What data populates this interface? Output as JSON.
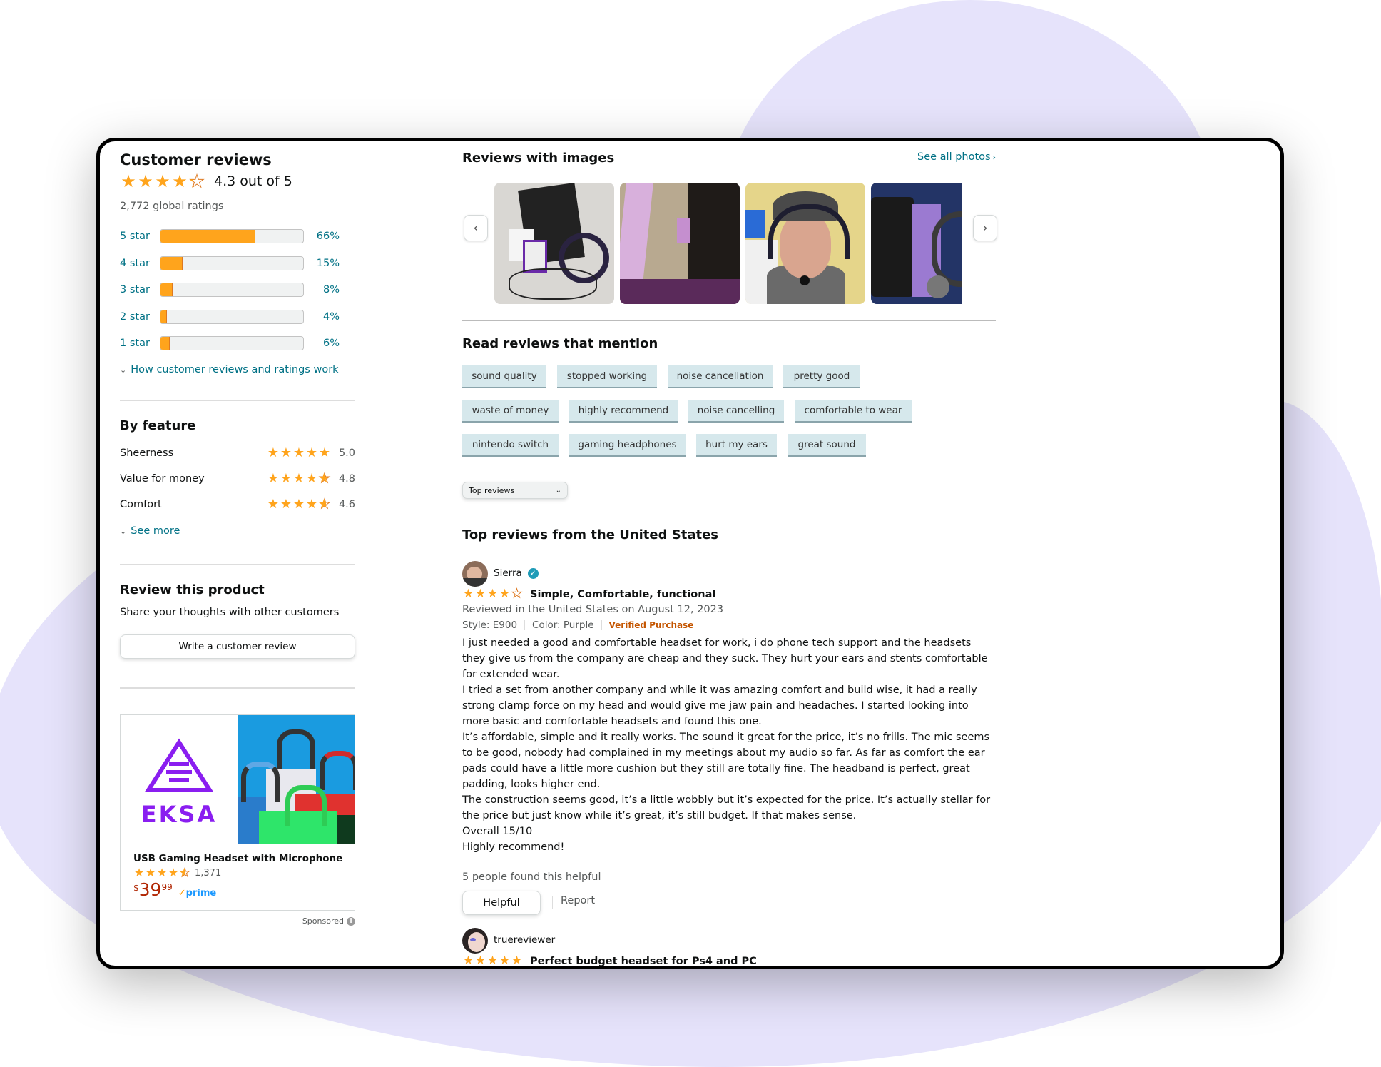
{
  "summary": {
    "title": "Customer reviews",
    "rating_value": 4.3,
    "rating_text": "4.3 out of 5",
    "global_ratings": "2,772 global ratings",
    "histogram": [
      {
        "label": "5 star",
        "percent": 66,
        "percent_text": "66%"
      },
      {
        "label": "4 star",
        "percent": 15,
        "percent_text": "15%"
      },
      {
        "label": "3 star",
        "percent": 8,
        "percent_text": "8%"
      },
      {
        "label": "2 star",
        "percent": 4,
        "percent_text": "4%"
      },
      {
        "label": "1 star",
        "percent": 6,
        "percent_text": "6%"
      }
    ],
    "how_link": "How customer reviews and ratings work"
  },
  "by_feature": {
    "title": "By feature",
    "items": [
      {
        "label": "Sheerness",
        "rating": 5.0,
        "value_text": "5.0"
      },
      {
        "label": "Value for money",
        "rating": 4.8,
        "value_text": "4.8"
      },
      {
        "label": "Comfort",
        "rating": 4.6,
        "value_text": "4.6"
      }
    ],
    "see_more": "See more"
  },
  "review_product": {
    "title": "Review this product",
    "subtitle": "Share your thoughts with other customers",
    "button_label": "Write a customer review"
  },
  "ad": {
    "brand": "EKSA",
    "title": "USB Gaming Headset with Microphone",
    "rating": 4.5,
    "rating_count": "1,371",
    "price_symbol": "$",
    "price_whole": "39",
    "price_fraction": "99",
    "prime_label": "prime",
    "sponsored_label": "Sponsored",
    "colors": {
      "brand_purple": "#8a1ef0",
      "price_red": "#b12704"
    }
  },
  "images_section": {
    "title": "Reviews with images",
    "see_all": "See all photos",
    "prev_icon": "chevron-left-icon",
    "next_icon": "chevron-right-icon",
    "images": [
      {
        "alt": "Headset with bag, cables and accessories on table"
      },
      {
        "alt": "Headset box interior"
      },
      {
        "alt": "Person wearing headset and cap"
      },
      {
        "alt": "Headset with carrying bag on blue background"
      }
    ]
  },
  "mentions": {
    "title": "Read reviews that mention",
    "rows": [
      [
        "sound quality",
        "stopped working",
        "noise cancellation",
        "pretty good"
      ],
      [
        "waste of money",
        "highly recommend",
        "noise cancelling",
        "comfortable to wear"
      ],
      [
        "nintendo switch",
        "gaming headphones",
        "hurt my ears",
        "great sound"
      ]
    ]
  },
  "sort": {
    "selected": "Top reviews"
  },
  "top_reviews": {
    "title": "Top reviews from the United States",
    "reviews": [
      {
        "author": "Sierra",
        "verified_badge": true,
        "rating": 4,
        "headline": "Simple, Comfortable, functional",
        "date_line": "Reviewed in the United States on August 12, 2023",
        "style": "Style: E900",
        "color": "Color: Purple",
        "verified": "Verified Purchase",
        "body": [
          "I just needed a good and comfortable headset for work, i do phone tech support and the headsets they give us from the company are cheap and they suck. They hurt your ears and stents comfortable for extended wear.",
          "I tried a set from another company and while it was amazing comfort and build wise, it had a really strong clamp force on my head and would give me jaw pain and headaches. I started looking into more basic and comfortable headsets and found this one.",
          "It’s affordable, simple and it really works. The sound it great for the price, it’s no frills. The mic seems to be good, nobody had complained in my meetings about my audio so far. As far as comfort the ear pads could have a little more cushion but they still are totally fine. The headband is perfect, great padding, looks higher end.",
          "The construction seems good, it’s a little wobbly but it’s expected for the price. It’s actually stellar for the price but just know while it’s great, it’s still budget. If that makes sense.",
          "Overall 15/10",
          "Highly recommend!"
        ],
        "helpful_count": "5 people found this helpful",
        "helpful_button": "Helpful",
        "report_link": "Report"
      },
      {
        "author": "truereviewer",
        "rating": 5,
        "headline": "Perfect budget headset for Ps4 and PC"
      }
    ]
  },
  "colors": {
    "star": "#ffa41c",
    "link": "#007185",
    "verified": "#c45500",
    "chip_bg": "#d6e8ec",
    "blob": "#e6e3fb"
  }
}
